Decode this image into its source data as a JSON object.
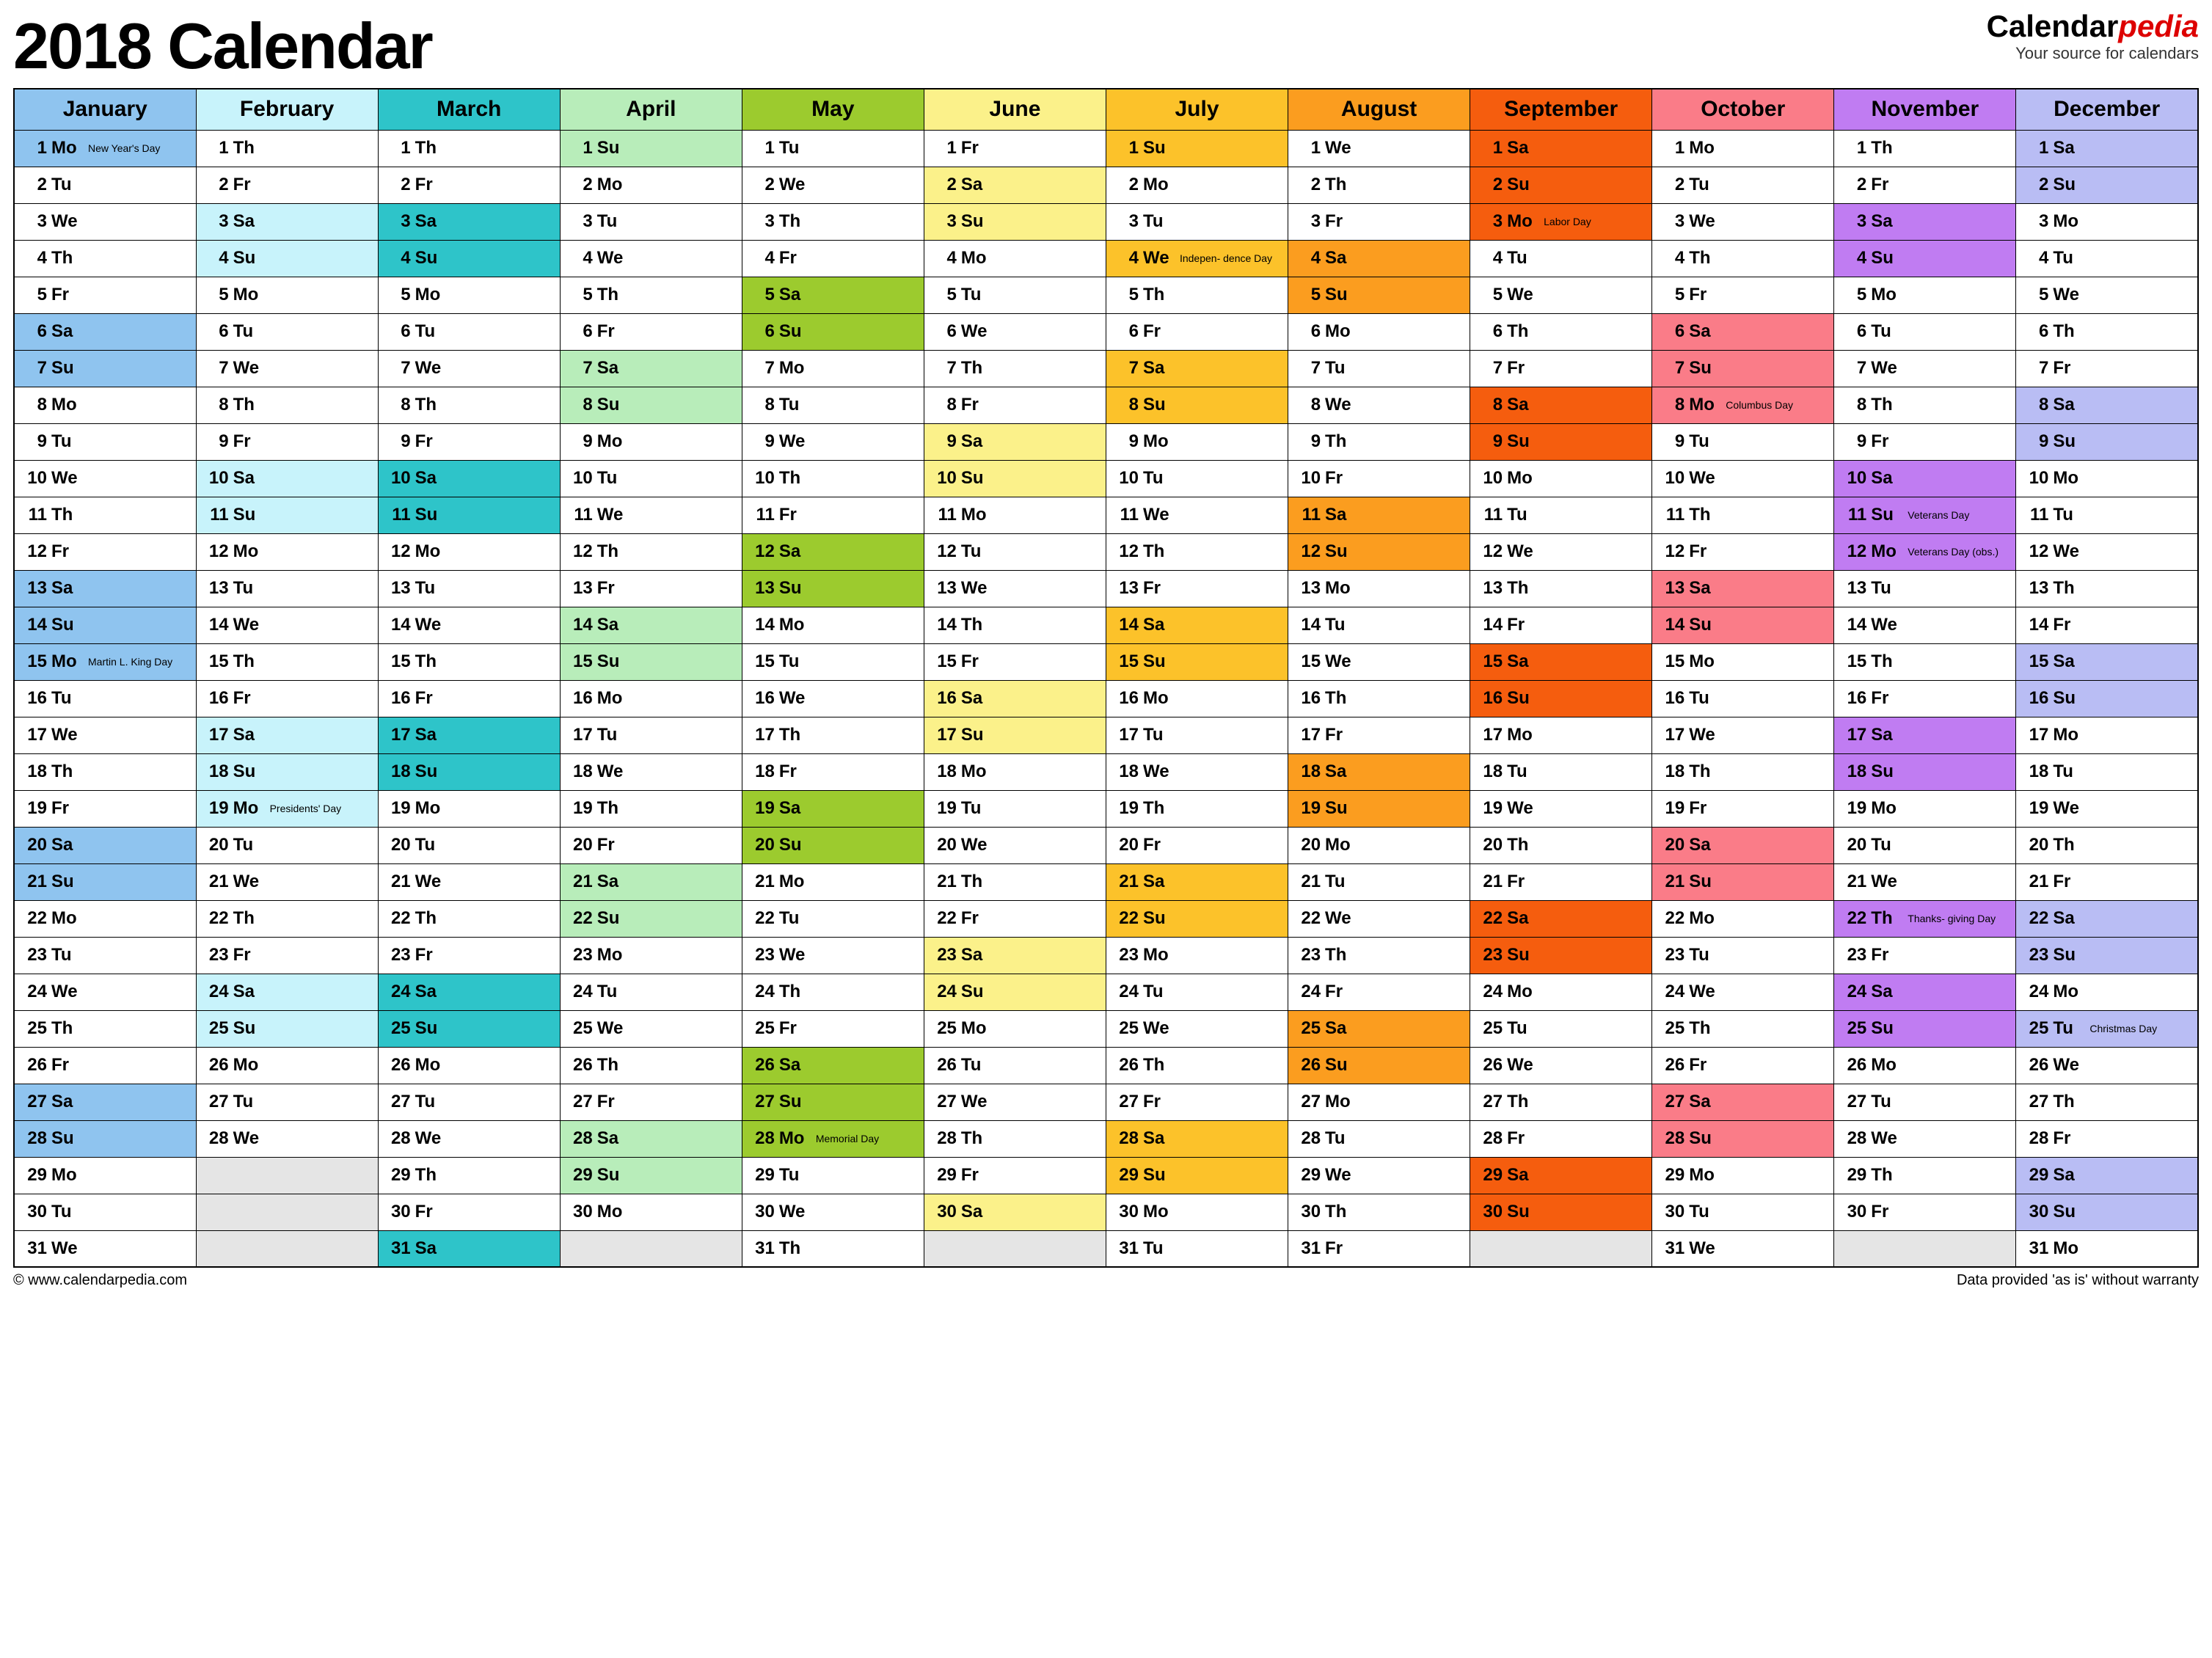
{
  "title": "2018 Calendar",
  "brand": {
    "name": "Calendar",
    "suffix": "pedia",
    "tagline": "Your source for calendars"
  },
  "footer": {
    "left": "© www.calendarpedia.com",
    "right": "Data provided 'as is' without warranty"
  },
  "dows": [
    "Su",
    "Mo",
    "Tu",
    "We",
    "Th",
    "Fr",
    "Sa"
  ],
  "monthColors": {
    "header": [
      "#8fc4ef",
      "#c8f3fb",
      "#2ec4c9",
      "#b8edba",
      "#9ccb2e",
      "#fbf18a",
      "#fcc22a",
      "#fb9d1f",
      "#f55d0e",
      "#fa7c88",
      "#c07cf2",
      "#b9bdf4"
    ],
    "sat": [
      "#8fc4ef",
      "#c8f3fb",
      "#2ec4c9",
      "#b8edba",
      "#9ccb2e",
      "#fbf18a",
      "#fcc22a",
      "#fb9d1f",
      "#f55d0e",
      "#fa7c88",
      "#c07cf2",
      "#b9bdf4"
    ],
    "sun": [
      "#8fc4ef",
      "#c8f3fb",
      "#2ec4c9",
      "#b8edba",
      "#9ccb2e",
      "#fbf18a",
      "#fcc22a",
      "#fb9d1f",
      "#f55d0e",
      "#fa7c88",
      "#c07cf2",
      "#b9bdf4"
    ]
  },
  "months": [
    {
      "name": "January",
      "startDow": 1,
      "days": 31,
      "holidays": {
        "1": {
          "note": "New Year's Day",
          "hl": 1
        },
        "15": {
          "note": "Martin L. King Day",
          "hl": 1
        }
      }
    },
    {
      "name": "February",
      "startDow": 4,
      "days": 28,
      "holidays": {
        "19": {
          "note": "Presidents' Day",
          "hl": 1
        }
      }
    },
    {
      "name": "March",
      "startDow": 4,
      "days": 31,
      "holidays": {}
    },
    {
      "name": "April",
      "startDow": 0,
      "days": 30,
      "holidays": {}
    },
    {
      "name": "May",
      "startDow": 2,
      "days": 31,
      "holidays": {
        "28": {
          "note": "Memorial Day",
          "hl": 1
        }
      }
    },
    {
      "name": "June",
      "startDow": 5,
      "days": 30,
      "holidays": {}
    },
    {
      "name": "July",
      "startDow": 0,
      "days": 31,
      "holidays": {
        "4": {
          "note": "Indepen- dence Day",
          "hl": 1
        }
      }
    },
    {
      "name": "August",
      "startDow": 3,
      "days": 31,
      "holidays": {}
    },
    {
      "name": "September",
      "startDow": 6,
      "days": 30,
      "holidays": {
        "3": {
          "note": "Labor Day",
          "hl": 1
        }
      }
    },
    {
      "name": "October",
      "startDow": 1,
      "days": 31,
      "holidays": {
        "8": {
          "note": "Columbus Day",
          "hl": 1
        }
      }
    },
    {
      "name": "November",
      "startDow": 4,
      "days": 30,
      "holidays": {
        "11": {
          "note": "Veterans Day",
          "hl": 0
        },
        "12": {
          "note": "Veterans Day (obs.)",
          "hl": 1
        },
        "22": {
          "note": "Thanks- giving Day",
          "hl": 1
        }
      }
    },
    {
      "name": "December",
      "startDow": 6,
      "days": 31,
      "holidays": {
        "25": {
          "note": "Christmas Day",
          "hl": 1
        }
      }
    }
  ]
}
